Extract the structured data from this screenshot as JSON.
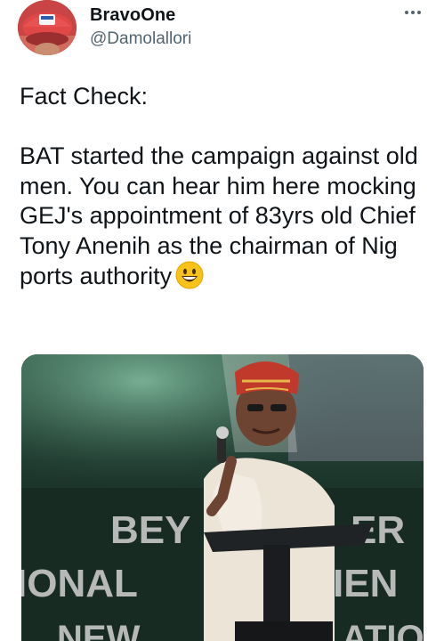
{
  "author": {
    "display_name": "BravoOne",
    "handle": "@Damolallori",
    "avatar_icon": "profile-photo-red-cap"
  },
  "more_icon": "ellipsis-icon",
  "tweet": {
    "text": "Fact Check:\n\nBAT started the campaign against old men. You can hear him here mocking GEJ's appointment of 83yrs old Chief Tony Anenih as the chairman of Nig ports authority",
    "emoji": "grinning-face"
  },
  "media": {
    "kind": "video-frame",
    "overlay_text_line1": "BEY    ER",
    "overlay_text_line2": "IONAL        MEN",
    "overlay_text_line3": "NEW        ATIO"
  },
  "colors": {
    "primary_text": "#0f1419",
    "secondary_text": "#536471",
    "background": "#ffffff"
  }
}
